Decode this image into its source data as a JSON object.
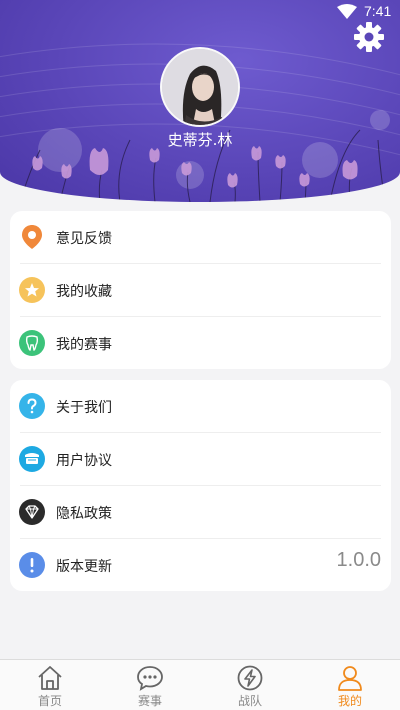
{
  "status_bar": {
    "time": "7:41"
  },
  "profile": {
    "username": "史蒂芬.林"
  },
  "menu_group_1": [
    {
      "label": "意见反馈",
      "icon": "location-pin-icon",
      "color": "#f0883a"
    },
    {
      "label": "我的收藏",
      "icon": "star-icon",
      "color": "#f6c35b"
    },
    {
      "label": "我的赛事",
      "icon": "tooth-icon",
      "color": "#3cc37a"
    }
  ],
  "menu_group_2": [
    {
      "label": "关于我们",
      "icon": "question-icon",
      "color": "#35b4e9"
    },
    {
      "label": "用户协议",
      "icon": "agreement-icon",
      "color": "#1ea9e2"
    },
    {
      "label": "隐私政策",
      "icon": "diamond-icon",
      "color": "#2b2b2b"
    },
    {
      "label": "版本更新",
      "icon": "exclamation-icon",
      "color": "#5a8de8",
      "value": "1.0.0"
    }
  ],
  "tabs": [
    {
      "label": "首页",
      "icon": "home-icon",
      "active": false
    },
    {
      "label": "赛事",
      "icon": "chat-bubble-icon",
      "active": false
    },
    {
      "label": "战队",
      "icon": "lightning-icon",
      "active": false
    },
    {
      "label": "我的",
      "icon": "person-icon",
      "active": true
    }
  ],
  "colors": {
    "header": "#5a46b8",
    "tab_active": "#f08a1c",
    "tab_inactive": "#888888"
  }
}
